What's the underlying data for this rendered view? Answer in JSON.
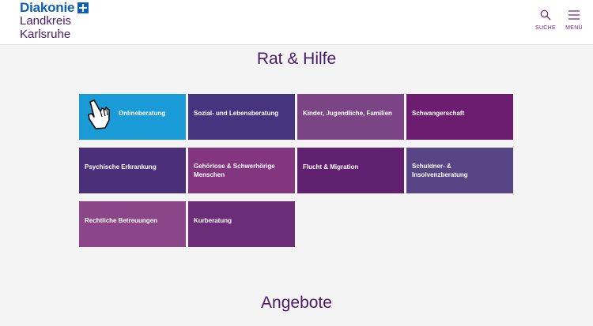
{
  "header": {
    "logo_brand": "Diakonie",
    "logo_line1": "Landkreis",
    "logo_line2": "Karlsruhe",
    "search_label": "SUCHE",
    "menu_label": "MENÜ"
  },
  "sections": {
    "rat_hilfe_title": "Rat & Hilfe",
    "angebote_title": "Angebote"
  },
  "tiles": [
    {
      "label": "Onlineberatung",
      "color": "#1a9ad6"
    },
    {
      "label": "Sozial- und Lebensberatung",
      "color": "#46347e"
    },
    {
      "label": "Kinder, Jugendliche, Familien",
      "color": "#7b4585"
    },
    {
      "label": "Schwangerschaft",
      "color": "#6c1d70"
    },
    {
      "label": "Psychische Erkrankung",
      "color": "#4b2f78"
    },
    {
      "label": "Gehörlose & Schwerhörige Menschen",
      "color": "#833580"
    },
    {
      "label": "Flucht & Migration",
      "color": "#5f2070"
    },
    {
      "label": "Schuldner- & Insolvenzberatung",
      "color": "#574585"
    },
    {
      "label": "Rechtliche Betreuungen",
      "color": "#8a4688"
    },
    {
      "label": "Kurberatung",
      "color": "#6b2d78"
    }
  ],
  "icons": {
    "search": "search-icon",
    "menu": "hamburger-menu-icon",
    "online": "pointing-hand-icon"
  }
}
